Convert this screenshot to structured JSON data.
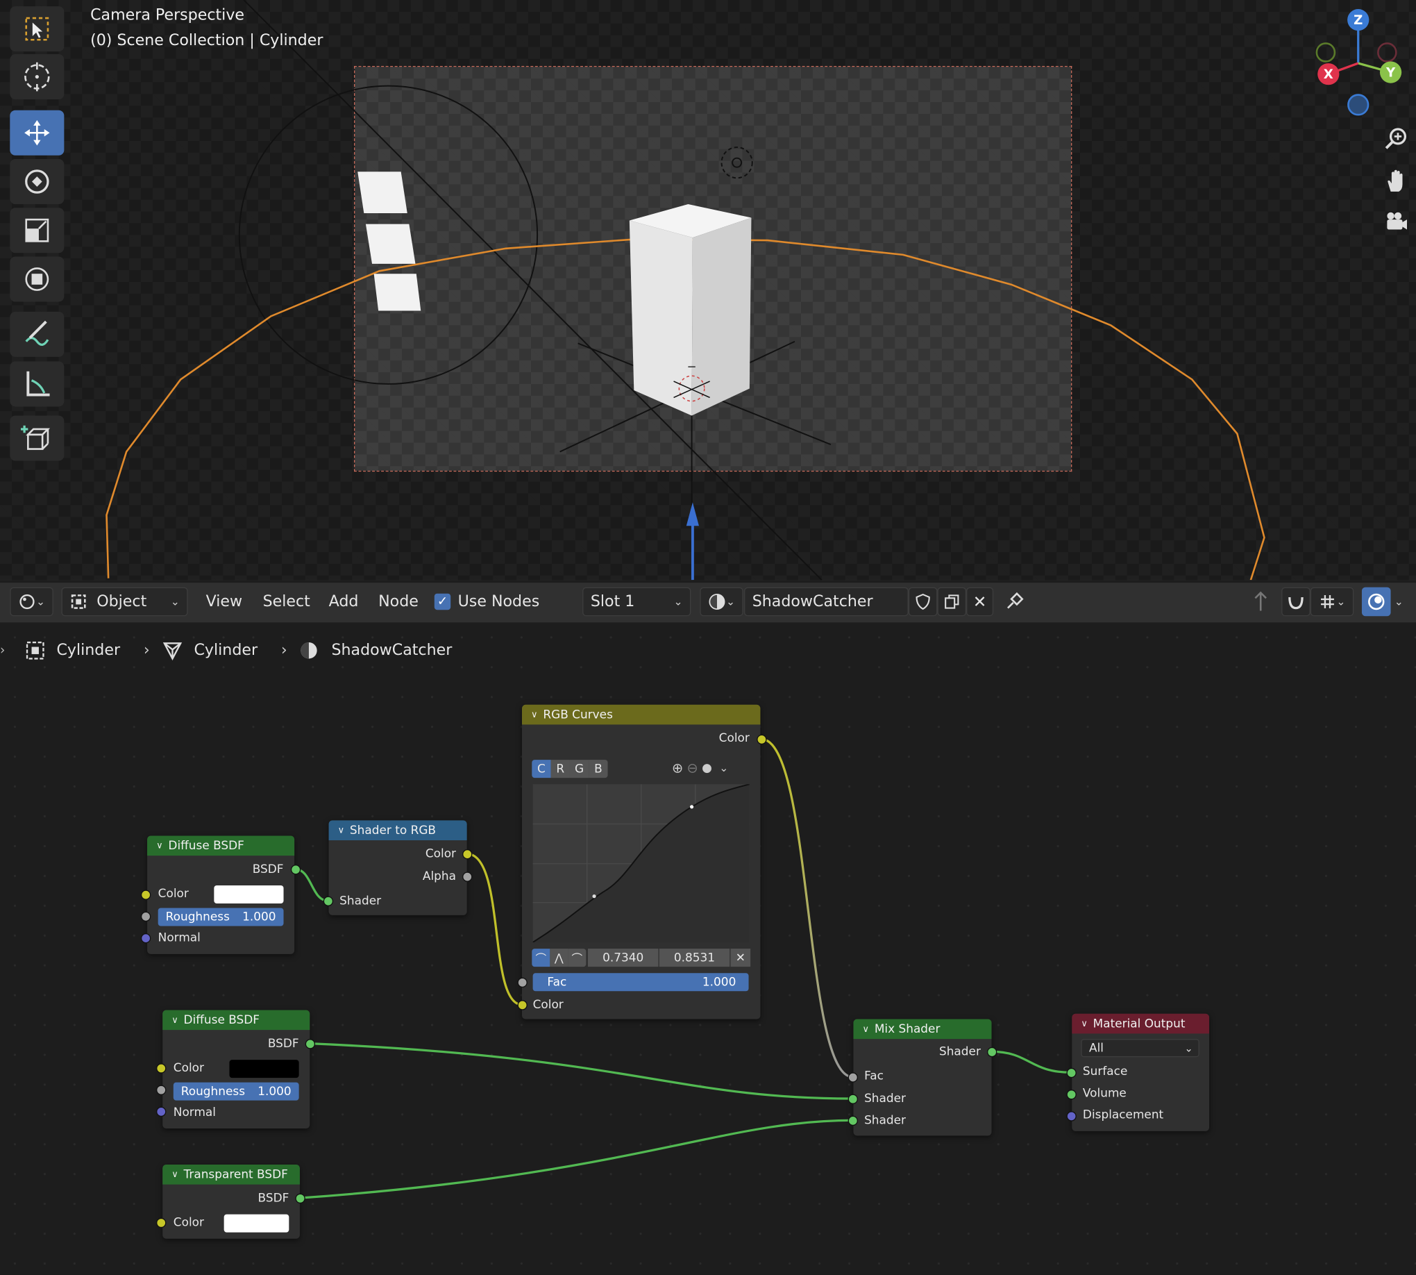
{
  "viewport": {
    "title": "Camera Perspective",
    "subtitle": "(0) Scene Collection | Cylinder",
    "gizmo": {
      "x": "X",
      "y": "Y",
      "z": "Z"
    },
    "tools": [
      "select-box-icon",
      "cursor-icon",
      "move-icon",
      "rotate-icon",
      "scale-icon",
      "transform-icon",
      "annotate-icon",
      "measure-icon",
      "add-cube-icon"
    ],
    "nav": [
      "zoom-icon",
      "pan-hand-icon",
      "camera-icon"
    ]
  },
  "header": {
    "mode": "Object",
    "menu": [
      "View",
      "Select",
      "Add",
      "Node"
    ],
    "use_nodes": "Use Nodes",
    "slot": "Slot 1",
    "material": "ShadowCatcher"
  },
  "breadcrumb": {
    "object": "Cylinder",
    "mesh": "Cylinder",
    "material": "ShadowCatcher"
  },
  "nodes": {
    "diffuse1": {
      "title": "Diffuse BSDF",
      "out": "BSDF",
      "color": "Color",
      "color_value": "#ffffff",
      "roughness": "Roughness",
      "roughness_value": "1.000",
      "normal": "Normal"
    },
    "shader_to_rgb": {
      "title": "Shader to RGB",
      "color": "Color",
      "alpha": "Alpha",
      "shader": "Shader"
    },
    "rgb_curves": {
      "title": "RGB Curves",
      "out": "Color",
      "channels": [
        "C",
        "R",
        "G",
        "B"
      ],
      "x": "0.7340",
      "y": "0.8531",
      "fac": "Fac",
      "fac_value": "1.000",
      "color": "Color"
    },
    "diffuse2": {
      "title": "Diffuse BSDF",
      "out": "BSDF",
      "color": "Color",
      "color_value": "#000000",
      "roughness": "Roughness",
      "roughness_value": "1.000",
      "normal": "Normal"
    },
    "transparent": {
      "title": "Transparent BSDF",
      "out": "BSDF",
      "color": "Color",
      "color_value": "#ffffff"
    },
    "mix": {
      "title": "Mix Shader",
      "out": "Shader",
      "fac": "Fac",
      "shader1": "Shader",
      "shader2": "Shader"
    },
    "output": {
      "title": "Material Output",
      "target": "All",
      "surface": "Surface",
      "volume": "Volume",
      "displacement": "Displacement"
    }
  },
  "colors": {
    "accent": "#4772b3",
    "shader_socket": "#63c763",
    "color_socket": "#c7c729",
    "selection_orange": "#e08a2c"
  }
}
